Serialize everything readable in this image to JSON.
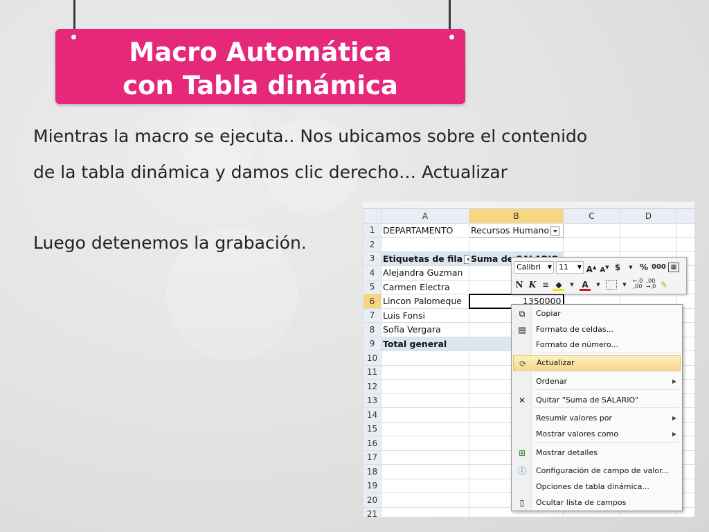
{
  "slide": {
    "title_line1": "Macro Automática",
    "title_line2": "con Tabla dinámica",
    "paragraph_line1": "Mientras la macro se ejecuta.. Nos ubicamos sobre el contenido",
    "paragraph_line2": "de la tabla dinámica y damos clic derecho… Actualizar",
    "paragraph_line3": "Luego detenemos la grabación.",
    "accent_color": "#e5287a"
  },
  "spreadsheet": {
    "columns": [
      "A",
      "B",
      "C",
      "D"
    ],
    "selected_column": "B",
    "selected_row": "6",
    "rows": [
      {
        "n": "1",
        "a": "DEPARTAMENTO",
        "b": "Recursos Humano"
      },
      {
        "n": "2",
        "a": "",
        "b": ""
      },
      {
        "n": "3",
        "a": "Etiquetas de fila",
        "b": "Suma de SALARIO"
      },
      {
        "n": "4",
        "a": "Alejandra Guzman",
        "b": ""
      },
      {
        "n": "5",
        "a": "Carmen Electra",
        "b": ""
      },
      {
        "n": "6",
        "a": "Lincon Palomeque",
        "b": "1350000"
      },
      {
        "n": "7",
        "a": "Luis Fonsi",
        "b": ""
      },
      {
        "n": "8",
        "a": "Sofia Vergara",
        "b": ""
      },
      {
        "n": "9",
        "a": "Total general",
        "b": ""
      },
      {
        "n": "10",
        "a": "",
        "b": ""
      },
      {
        "n": "11",
        "a": "",
        "b": ""
      },
      {
        "n": "12",
        "a": "",
        "b": ""
      },
      {
        "n": "13",
        "a": "",
        "b": ""
      },
      {
        "n": "14",
        "a": "",
        "b": ""
      },
      {
        "n": "15",
        "a": "",
        "b": ""
      },
      {
        "n": "16",
        "a": "",
        "b": ""
      },
      {
        "n": "17",
        "a": "",
        "b": ""
      },
      {
        "n": "18",
        "a": "",
        "b": ""
      },
      {
        "n": "19",
        "a": "",
        "b": ""
      },
      {
        "n": "20",
        "a": "",
        "b": ""
      },
      {
        "n": "21",
        "a": "",
        "b": ""
      }
    ]
  },
  "mini_toolbar": {
    "font_name": "Calibri",
    "font_size": "11",
    "bold": "N",
    "italic": "K",
    "currency": "$",
    "percent": "%",
    "thousands": "000",
    "font_color_letter": "A"
  },
  "context_menu": {
    "items": [
      {
        "label": "Copiar",
        "icon": "copy-icon",
        "submenu": false,
        "highlighted": false
      },
      {
        "label": "Formato de celdas...",
        "icon": "format-cells-icon",
        "submenu": false,
        "highlighted": false
      },
      {
        "label": "Formato de número...",
        "icon": "",
        "submenu": false,
        "highlighted": false
      },
      {
        "label": "Actualizar",
        "icon": "refresh-icon",
        "submenu": false,
        "highlighted": true
      },
      {
        "label": "Ordenar",
        "icon": "",
        "submenu": true,
        "highlighted": false
      },
      {
        "label": "Quitar \"Suma de SALARIO\"",
        "icon": "remove-x-icon",
        "submenu": false,
        "highlighted": false
      },
      {
        "label": "Resumir valores por",
        "icon": "",
        "submenu": true,
        "highlighted": false
      },
      {
        "label": "Mostrar valores como",
        "icon": "",
        "submenu": true,
        "highlighted": false
      },
      {
        "label": "Mostrar detalles",
        "icon": "show-details-icon",
        "submenu": false,
        "highlighted": false
      },
      {
        "label": "Configuración de campo de valor...",
        "icon": "field-settings-icon",
        "submenu": false,
        "highlighted": false
      },
      {
        "label": "Opciones de tabla dinámica...",
        "icon": "",
        "submenu": false,
        "highlighted": false
      },
      {
        "label": "Ocultar lista de campos",
        "icon": "field-list-icon",
        "submenu": false,
        "highlighted": false
      }
    ]
  }
}
